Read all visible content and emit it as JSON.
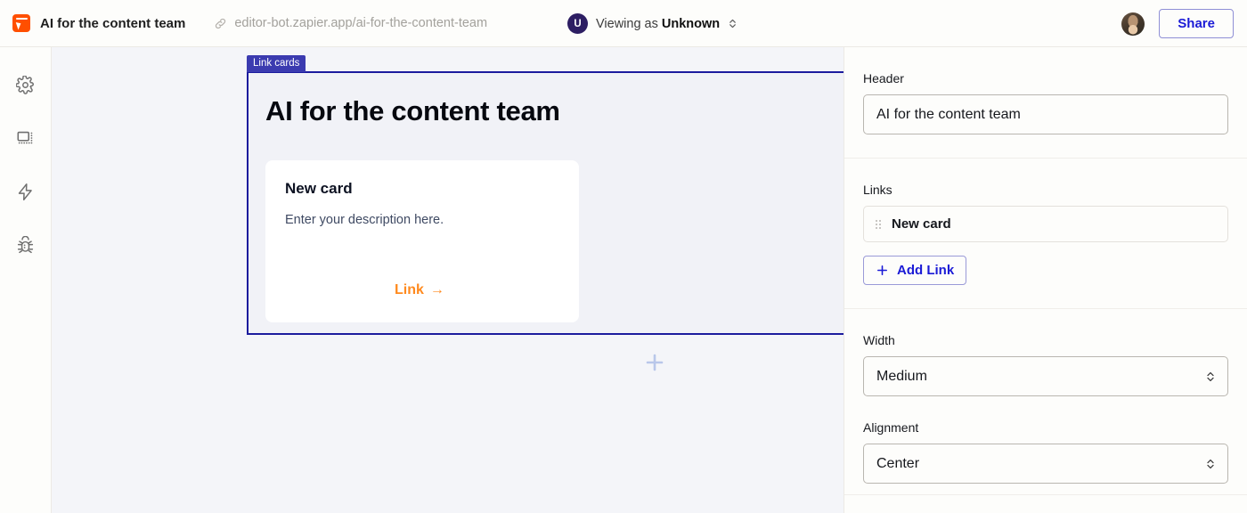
{
  "topbar": {
    "app_icon_name": "zapier-interfaces-icon",
    "doc_title": "AI for the content team",
    "link_icon_name": "link-icon",
    "url": "editor-bot.zapier.app/ai-for-the-content-team",
    "viewer_avatar_initial": "U",
    "viewing_prefix": "Viewing as ",
    "viewing_user": "Unknown",
    "viewing_stepper_icon": "chevron-up-down-icon",
    "account_avatar_name": "user-avatar",
    "share_label": "Share"
  },
  "rail": {
    "items": [
      {
        "name": "sidebar-item-settings",
        "icon": "gear-icon"
      },
      {
        "name": "sidebar-item-pages",
        "icon": "layout-page-icon"
      },
      {
        "name": "sidebar-item-actions",
        "icon": "lightning-bolt-icon"
      },
      {
        "name": "sidebar-item-debug",
        "icon": "bug-icon"
      }
    ]
  },
  "canvas": {
    "block_tag": "Link cards",
    "block_title": "AI for the content team",
    "card": {
      "title": "New card",
      "description": "Enter your description here.",
      "link_label": "Link",
      "link_arrow": "→"
    },
    "add_block_icon": "plus-icon"
  },
  "panel": {
    "header": {
      "label": "Header",
      "value": "AI for the content team",
      "placeholder": "Header"
    },
    "links": {
      "label": "Links",
      "drag_icon": "drag-handle-icon",
      "items": [
        {
          "label": "New card"
        }
      ],
      "add_icon": "plus-icon",
      "add_label": "Add Link"
    },
    "width": {
      "label": "Width",
      "value": "Medium",
      "stepper_icon": "chevron-up-down-icon"
    },
    "alignment": {
      "label": "Alignment",
      "value": "Center",
      "stepper_icon": "chevron-up-down-icon"
    }
  },
  "colors": {
    "brand_orange": "#ff4f00",
    "accent_blue": "#1a1ad6",
    "selection_navy": "#1c1c9e",
    "link_orange": "#ff8a1e"
  }
}
